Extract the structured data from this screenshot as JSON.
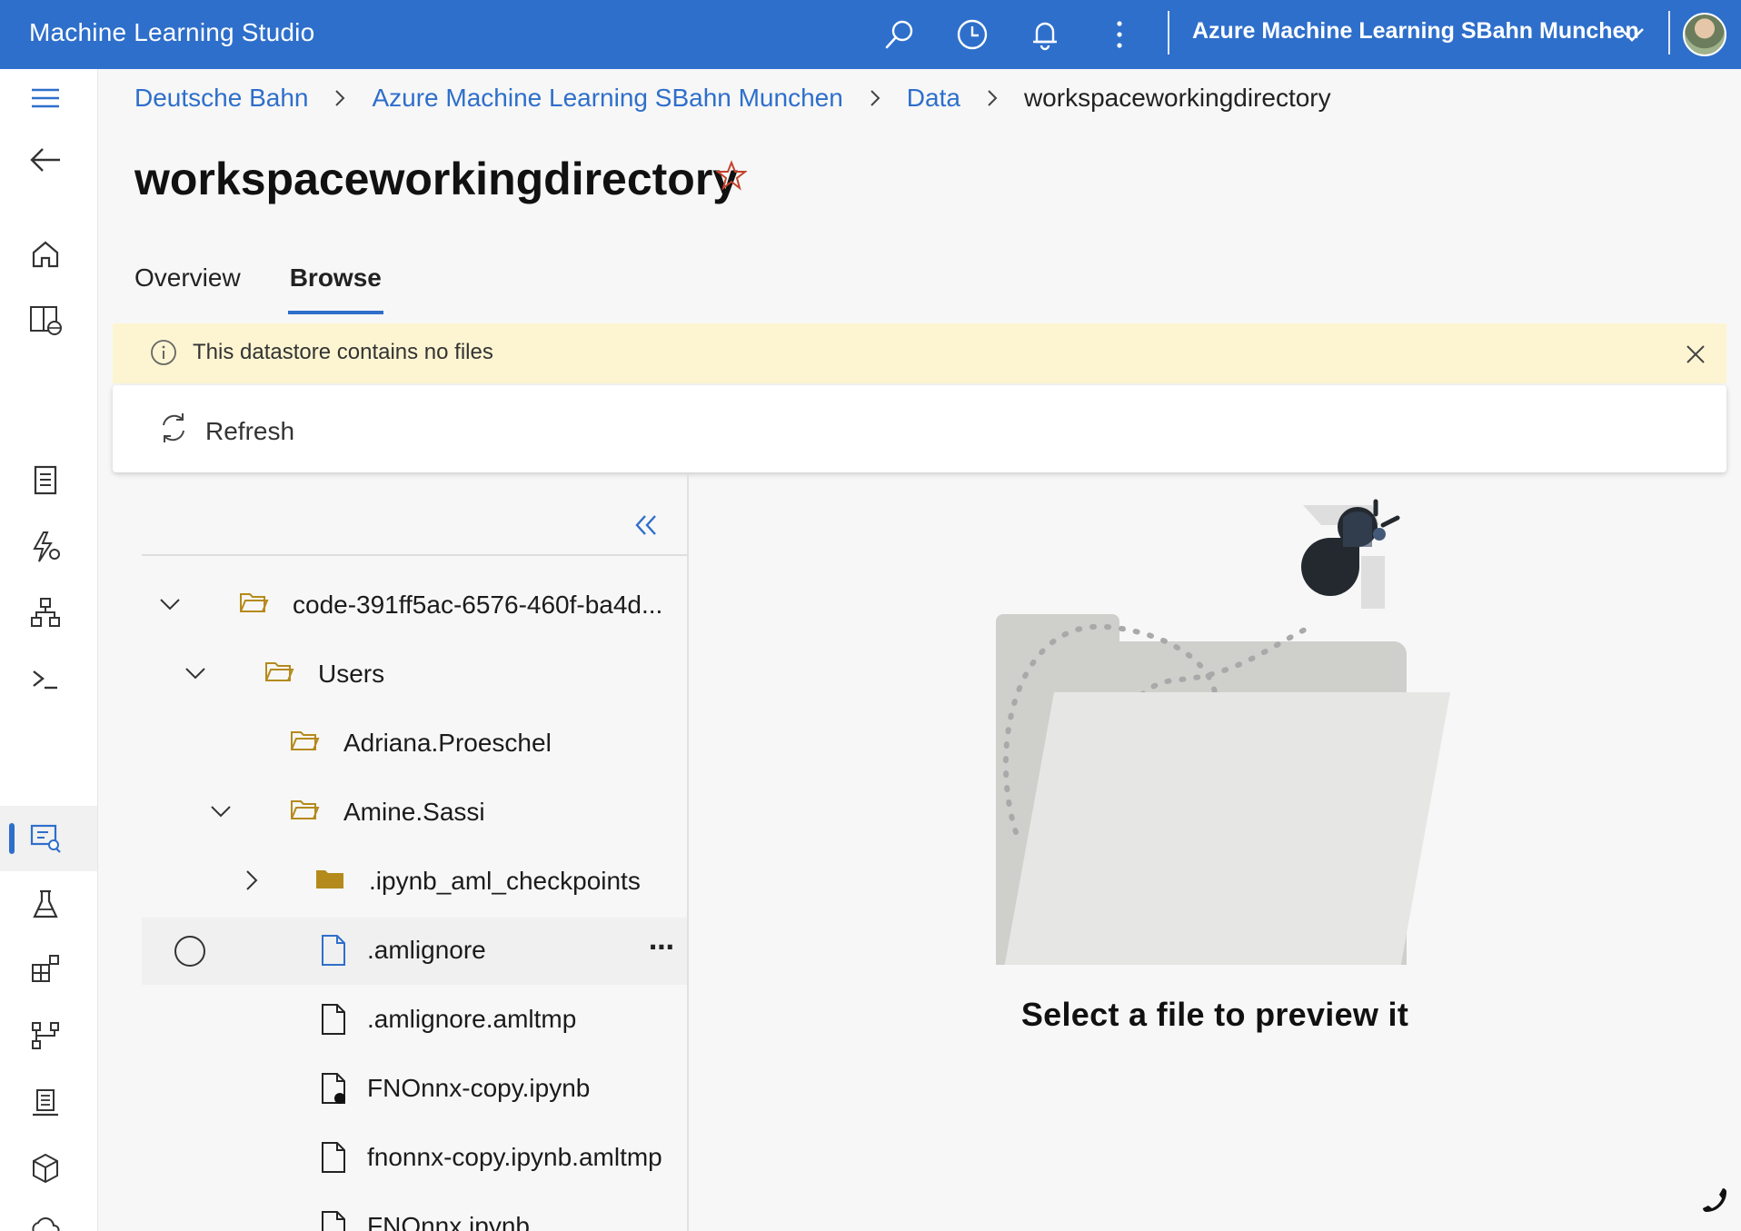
{
  "app": {
    "title": "Machine Learning Studio",
    "workspace": "Azure Machine Learning SBahn Munchen",
    "accent": "#2e6fcb",
    "header_icons": [
      "search-icon",
      "history-icon",
      "bell-icon",
      "more-icon"
    ]
  },
  "rail": {
    "icons": [
      "menu-icon",
      "back-icon",
      "home-icon",
      "model-catalog-icon",
      "notebooks-icon",
      "automl-icon",
      "designer-icon",
      "prompt-flow-icon",
      "data-icon",
      "jobs-icon",
      "components-icon",
      "pipelines-icon",
      "environments-icon",
      "models-icon",
      "compute-icon"
    ]
  },
  "breadcrumb": {
    "items": [
      "Deutsche Bahn",
      "Azure Machine Learning SBahn Munchen",
      "Data"
    ],
    "current": "workspaceworkingdirectory"
  },
  "page": {
    "title": "workspaceworkingdirectory",
    "tabs": [
      "Overview",
      "Browse"
    ],
    "selected_tab": "Browse"
  },
  "banner": {
    "message": "This datastore contains no files"
  },
  "toolbar": {
    "refresh_label": "Refresh"
  },
  "tree": {
    "rows": [
      {
        "name": "code-391ff5ac-6576-460f-ba4d...",
        "type": "folder",
        "expanded": true
      },
      {
        "name": "Users",
        "type": "folder",
        "expanded": true
      },
      {
        "name": "Adriana.Proeschel",
        "type": "folder"
      },
      {
        "name": "Amine.Sassi",
        "type": "folder",
        "expanded": true
      },
      {
        "name": ".ipynb_aml_checkpoints",
        "type": "folder-filled",
        "expanded": false
      },
      {
        "name": ".amlignore",
        "type": "file",
        "highlighted": true
      },
      {
        "name": ".amlignore.amltmp",
        "type": "file"
      },
      {
        "name": "FNOnnx-copy.ipynb",
        "type": "notebook"
      },
      {
        "name": "fnonnx-copy.ipynb.amltmp",
        "type": "file"
      },
      {
        "name": "FNOnnx.ipynb",
        "type": "notebook"
      }
    ]
  },
  "preview": {
    "empty_message": "Select a file to preview it"
  }
}
